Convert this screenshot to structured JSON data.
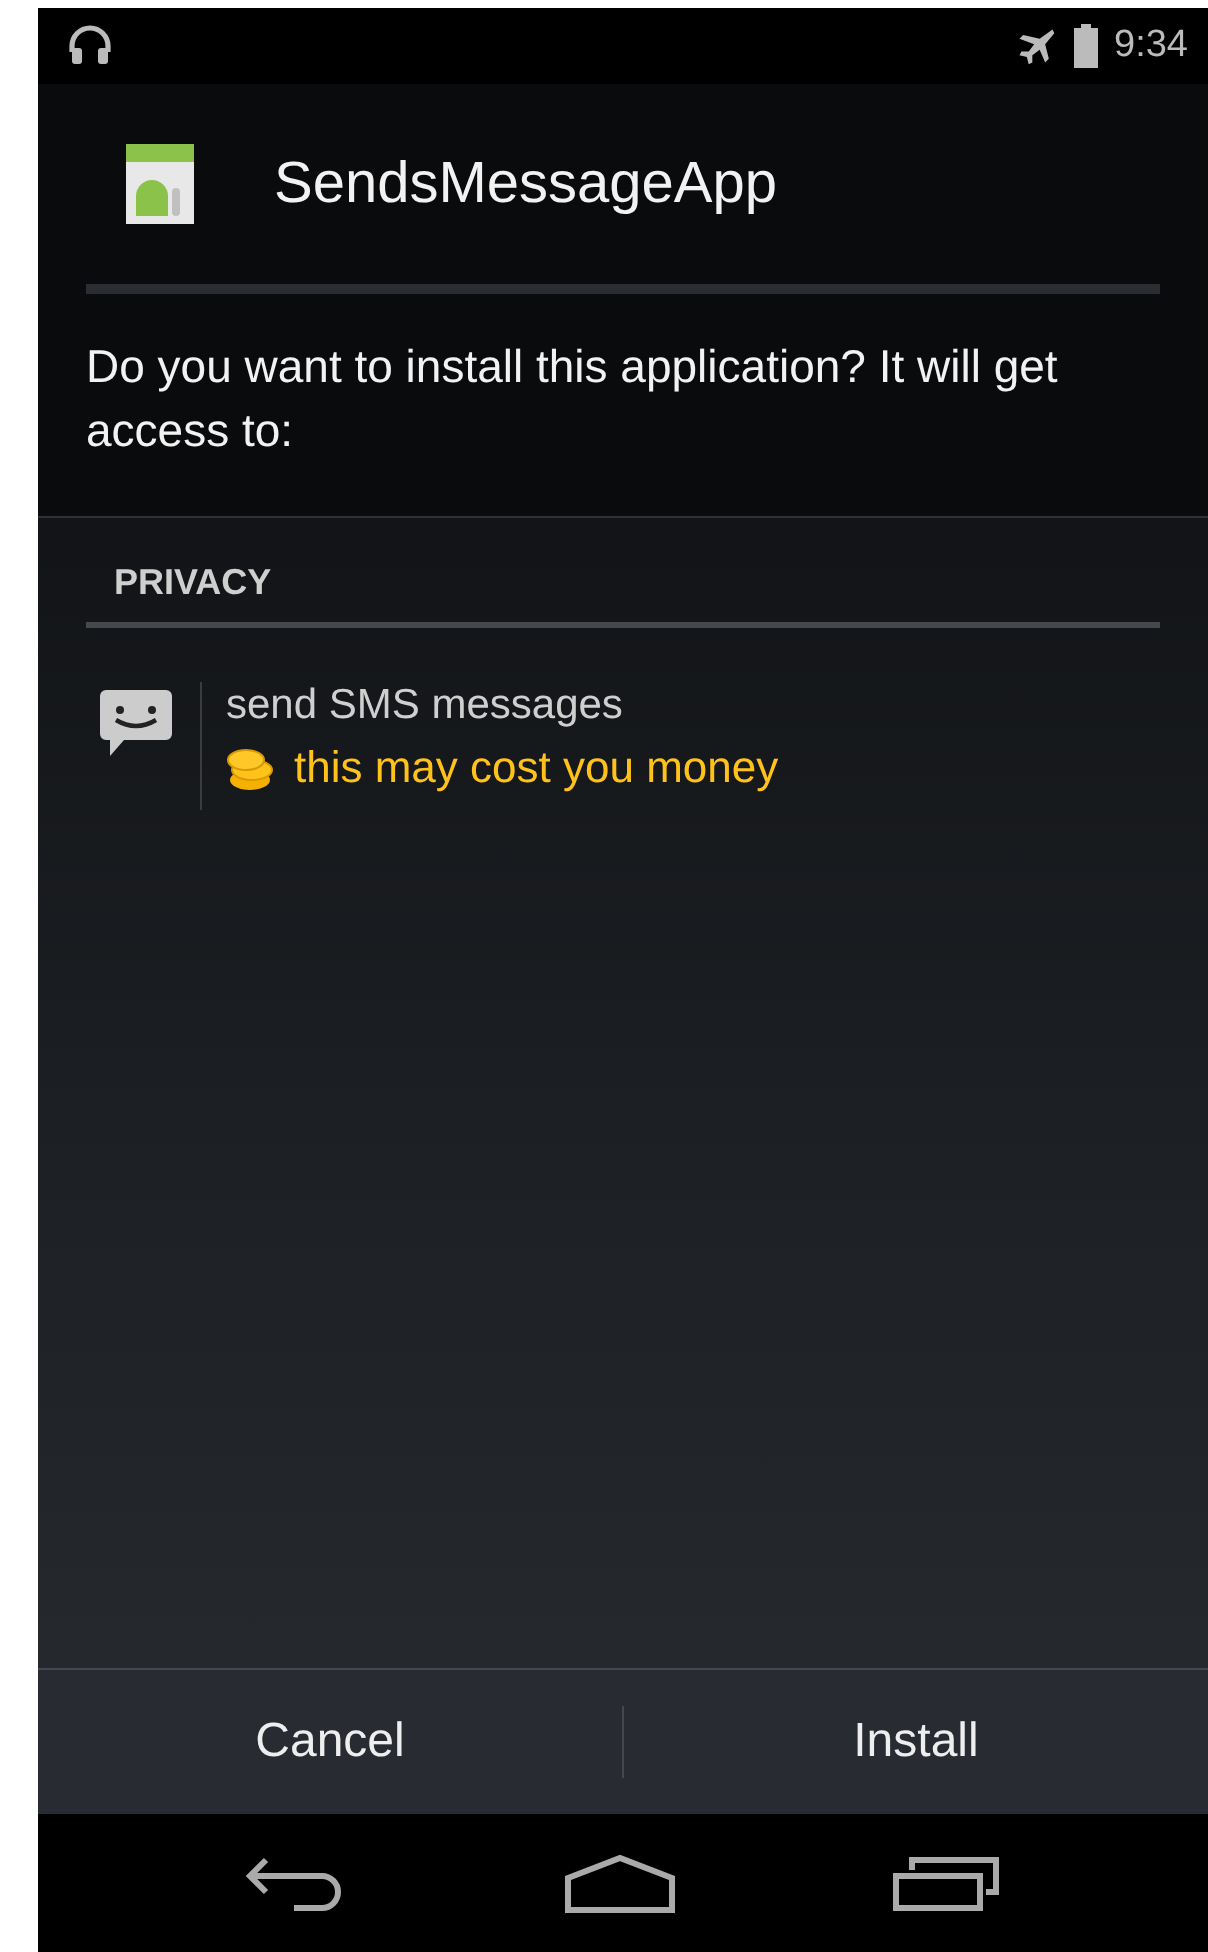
{
  "status_bar": {
    "time": "9:34"
  },
  "app": {
    "name": "SendsMessageApp"
  },
  "prompt": "Do you want to install this application? It will get access to:",
  "section": {
    "title": "PRIVACY"
  },
  "permissions": [
    {
      "label": "send SMS messages",
      "warning": "this may cost you money"
    }
  ],
  "buttons": [
    "Cancel",
    "Install"
  ]
}
